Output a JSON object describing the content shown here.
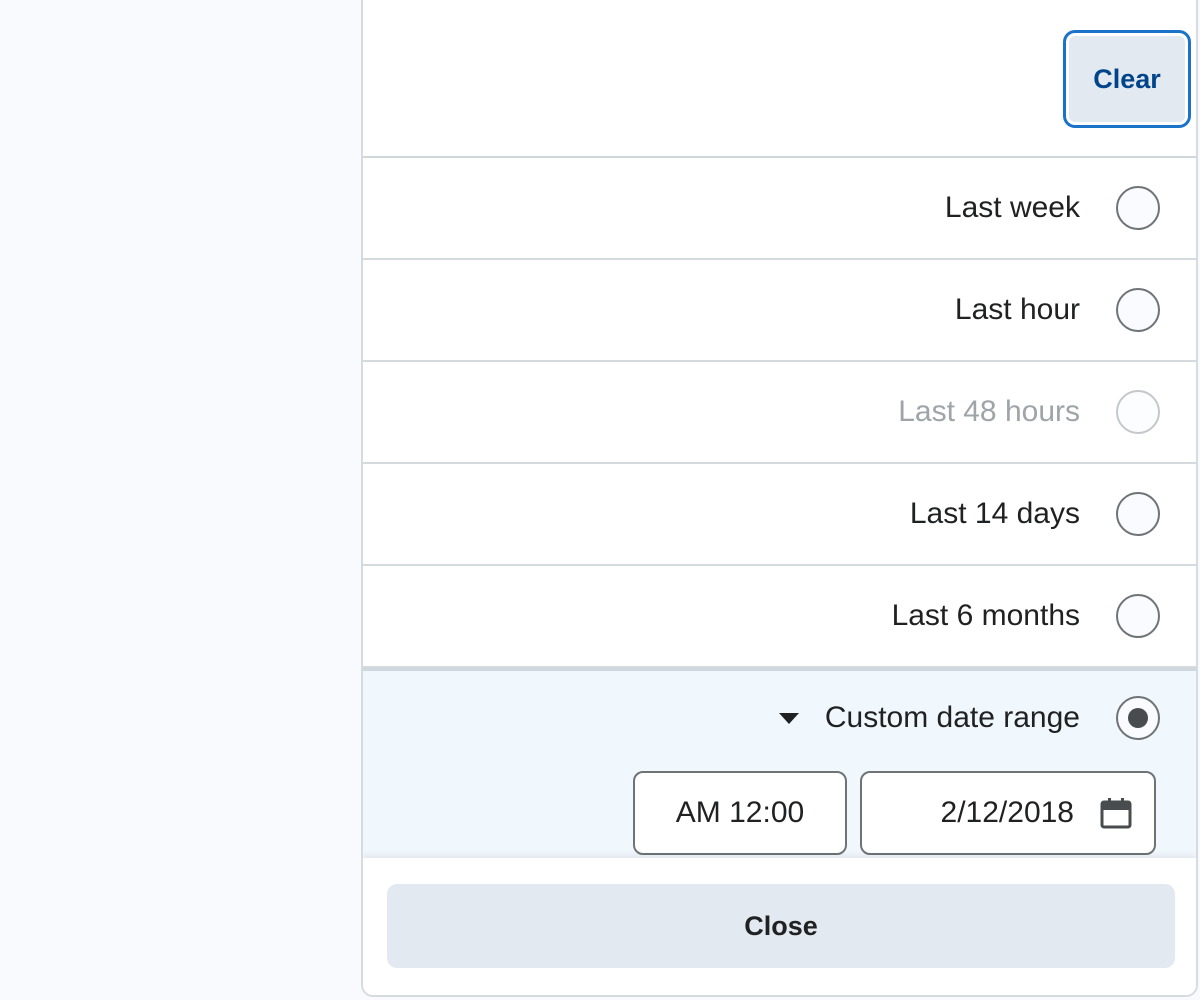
{
  "header": {
    "clear_label": "Clear"
  },
  "options": [
    {
      "label": "Last week",
      "selected": false,
      "disabled": false
    },
    {
      "label": "Last hour",
      "selected": false,
      "disabled": false
    },
    {
      "label": "Last 48 hours",
      "selected": false,
      "disabled": true
    },
    {
      "label": "Last 14 days",
      "selected": false,
      "disabled": false
    },
    {
      "label": "Last 6 months",
      "selected": false,
      "disabled": false
    }
  ],
  "custom": {
    "label": "Custom date range",
    "selected": true,
    "expanded": true,
    "time_value": "AM 12:00",
    "date_value": "2/12/2018"
  },
  "footer": {
    "close_label": "Close"
  },
  "icons": {
    "caret": "caret-down-icon",
    "calendar": "calendar-icon"
  }
}
